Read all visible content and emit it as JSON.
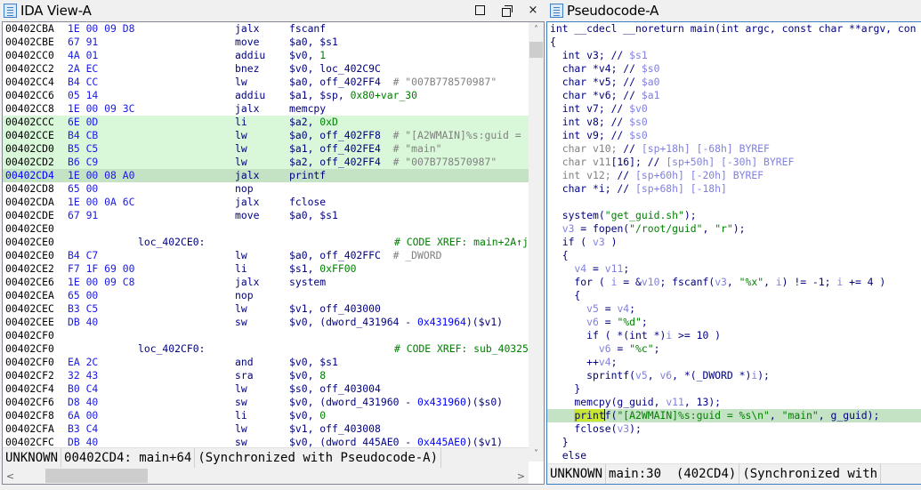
{
  "ida_view": {
    "title": "IDA View-A",
    "window_buttons": {
      "maximize": "maximize-icon",
      "restore": "restore-icon",
      "close": "×"
    },
    "lines": [
      {
        "addr": "00402CBA",
        "bytes": "1E 00 09 D8",
        "mnem": "jalx",
        "ops": "fscanf"
      },
      {
        "addr": "00402CBE",
        "bytes": "67 91",
        "mnem": "move",
        "ops": "$a0, $s1"
      },
      {
        "addr": "00402CC0",
        "bytes": "4A 01",
        "mnem": "addiu",
        "ops": "$v0, ",
        "num": "1"
      },
      {
        "addr": "00402CC2",
        "bytes": "2A EC",
        "mnem": "bnez",
        "ops": "$v0, loc_402C9C"
      },
      {
        "addr": "00402CC4",
        "bytes": "B4 CC",
        "mnem": "lw",
        "ops": "$a0, off_402FF4",
        "comment": "  # \"007B778570987\""
      },
      {
        "addr": "00402CC6",
        "bytes": "05 14",
        "mnem": "addiu",
        "ops": "$a1, $sp, ",
        "num": "0x80+var_30"
      },
      {
        "addr": "00402CC8",
        "bytes": "1E 00 09 3C",
        "mnem": "jalx",
        "ops": "memcpy"
      },
      {
        "addr": "00402CCC",
        "bytes": "6E 0D",
        "mnem": "li",
        "ops": "$a2, ",
        "num": "0xD",
        "state": "hl"
      },
      {
        "addr": "00402CCE",
        "bytes": "B4 CB",
        "mnem": "lw",
        "ops": "$a0, off_402FF8",
        "comment": "  # \"[A2WMAIN]%s:guid =",
        "state": "hl"
      },
      {
        "addr": "00402CD0",
        "bytes": "B5 C5",
        "mnem": "lw",
        "ops": "$a1, off_402FE4",
        "comment": "  # \"main\"",
        "state": "hl"
      },
      {
        "addr": "00402CD2",
        "bytes": "B6 C9",
        "mnem": "lw",
        "ops": "$a2, off_402FF4",
        "comment": "  # \"007B778570987\"",
        "state": "hl"
      },
      {
        "addr": "00402CD4",
        "bytes": "1E 00 08 A0",
        "mnem": "jalx",
        "ops": "printf",
        "state": "cur"
      },
      {
        "addr": "00402CD8",
        "bytes": "65 00",
        "mnem": "nop",
        "ops": ""
      },
      {
        "addr": "00402CDA",
        "bytes": "1E 00 0A 6C",
        "mnem": "jalx",
        "ops": "fclose"
      },
      {
        "addr": "00402CDE",
        "bytes": "67 91",
        "mnem": "move",
        "ops": "$a0, $s1"
      },
      {
        "addr": "00402CE0",
        "bytes": "",
        "mnem": "",
        "ops": ""
      },
      {
        "addr": "00402CE0",
        "label": "loc_402CE0:",
        "xref": "# CODE XREF: main+2A↑j"
      },
      {
        "addr": "00402CE0",
        "bytes": "B4 C7",
        "mnem": "lw",
        "ops": "$a0, off_402FFC",
        "comment": "  # _DWORD"
      },
      {
        "addr": "00402CE2",
        "bytes": "F7 1F 69 00",
        "mnem": "li",
        "ops": "$s1, ",
        "num": "0xFF00"
      },
      {
        "addr": "00402CE6",
        "bytes": "1E 00 09 C8",
        "mnem": "jalx",
        "ops": "system"
      },
      {
        "addr": "00402CEA",
        "bytes": "65 00",
        "mnem": "nop",
        "ops": ""
      },
      {
        "addr": "00402CEC",
        "bytes": "B3 C5",
        "mnem": "lw",
        "ops": "$v1, off_403000"
      },
      {
        "addr": "00402CEE",
        "bytes": "DB 40",
        "mnem": "sw",
        "ops": "$v0, (dword_431964 - ",
        "numblue": "0x431964",
        "ops_tail": ")($v1)"
      },
      {
        "addr": "00402CF0",
        "bytes": "",
        "mnem": "",
        "ops": ""
      },
      {
        "addr": "00402CF0",
        "label": "loc_402CF0:",
        "xref": "# CODE XREF: sub_40325"
      },
      {
        "addr": "00402CF0",
        "bytes": "EA 2C",
        "mnem": "and",
        "ops": "$v0, $s1"
      },
      {
        "addr": "00402CF2",
        "bytes": "32 43",
        "mnem": "sra",
        "ops": "$v0, ",
        "num": "8"
      },
      {
        "addr": "00402CF4",
        "bytes": "B0 C4",
        "mnem": "lw",
        "ops": "$s0, off_403004"
      },
      {
        "addr": "00402CF6",
        "bytes": "D8 40",
        "mnem": "sw",
        "ops": "$v0, (dword_431960 - ",
        "numblue": "0x431960",
        "ops_tail": ")($s0)"
      },
      {
        "addr": "00402CF8",
        "bytes": "6A 00",
        "mnem": "li",
        "ops": "$v0, ",
        "num": "0"
      },
      {
        "addr": "00402CFA",
        "bytes": "B3 C4",
        "mnem": "lw",
        "ops": "$v1, off_403008"
      },
      {
        "addr": "00402CFC",
        "bytes": "DB 40",
        "mnem": "sw",
        "ops": "$v0, (dword_445AE0 - ",
        "numblue": "0x445AE0",
        "ops_tail": ")($v1)"
      }
    ],
    "status": {
      "state": "UNKNOWN",
      "location": "00402CD4: main+64",
      "sync": "(Synchronized with Pseudocode-A)"
    }
  },
  "pseudocode": {
    "title": "Pseudocode-A",
    "lines": [
      [
        [
          "kw",
          "int __cdecl __noreturn main(int argc, const char **argv, con"
        ]
      ],
      [
        [
          "kw",
          "{"
        ]
      ],
      [
        [
          "kw",
          "  int v3; // "
        ],
        [
          "var",
          "$s1"
        ]
      ],
      [
        [
          "kw",
          "  char *v4; // "
        ],
        [
          "var",
          "$s0"
        ]
      ],
      [
        [
          "kw",
          "  char *v5; // "
        ],
        [
          "var",
          "$a0"
        ]
      ],
      [
        [
          "kw",
          "  char *v6; // "
        ],
        [
          "var",
          "$a1"
        ]
      ],
      [
        [
          "kw",
          "  int v7; // "
        ],
        [
          "var",
          "$v0"
        ]
      ],
      [
        [
          "kw",
          "  int v8; // "
        ],
        [
          "var",
          "$s0"
        ]
      ],
      [
        [
          "kw",
          "  int v9; // "
        ],
        [
          "var",
          "$s0"
        ]
      ],
      [
        [
          "grey",
          "  char v10; "
        ],
        [
          "kw",
          "// "
        ],
        [
          "var",
          "[sp+18h] [-68h] BYREF"
        ]
      ],
      [
        [
          "grey",
          "  char v11"
        ],
        [
          "kw",
          "[16]; // "
        ],
        [
          "var",
          "[sp+50h] [-30h] BYREF"
        ]
      ],
      [
        [
          "grey",
          "  int v12; "
        ],
        [
          "kw",
          "// "
        ],
        [
          "var",
          "[sp+60h] [-20h] BYREF"
        ]
      ],
      [
        [
          "kw",
          "  char *i; // "
        ],
        [
          "var",
          "[sp+68h] [-18h]"
        ]
      ],
      [
        [
          "kw",
          ""
        ]
      ],
      [
        [
          "kw",
          "  system("
        ],
        [
          "str",
          "\"get_guid.sh\""
        ],
        [
          "kw",
          ");"
        ]
      ],
      [
        [
          "var",
          "  v3"
        ],
        [
          "kw",
          " = fopen("
        ],
        [
          "str",
          "\"/root/guid\""
        ],
        [
          "kw",
          ", "
        ],
        [
          "str",
          "\"r\""
        ],
        [
          "kw",
          ");"
        ]
      ],
      [
        [
          "kw",
          "  if ( "
        ],
        [
          "var",
          "v3"
        ],
        [
          "kw",
          " )"
        ]
      ],
      [
        [
          "kw",
          "  {"
        ]
      ],
      [
        [
          "var",
          "    v4"
        ],
        [
          "kw",
          " = "
        ],
        [
          "var",
          "v11"
        ],
        [
          "kw",
          ";"
        ]
      ],
      [
        [
          "kw",
          "    for ( "
        ],
        [
          "var",
          "i"
        ],
        [
          "kw",
          " = &"
        ],
        [
          "var",
          "v10"
        ],
        [
          "kw",
          "; fscanf("
        ],
        [
          "var",
          "v3"
        ],
        [
          "kw",
          ", "
        ],
        [
          "str",
          "\"%x\""
        ],
        [
          "kw",
          ", "
        ],
        [
          "var",
          "i"
        ],
        [
          "kw",
          ") != -1; "
        ],
        [
          "var",
          "i"
        ],
        [
          "kw",
          " += 4 )"
        ]
      ],
      [
        [
          "kw",
          "    {"
        ]
      ],
      [
        [
          "var",
          "      v5"
        ],
        [
          "kw",
          " = "
        ],
        [
          "var",
          "v4"
        ],
        [
          "kw",
          ";"
        ]
      ],
      [
        [
          "var",
          "      v6"
        ],
        [
          "kw",
          " = "
        ],
        [
          "str",
          "\"%d\""
        ],
        [
          "kw",
          ";"
        ]
      ],
      [
        [
          "kw",
          "      if ( *(int *)"
        ],
        [
          "var",
          "i"
        ],
        [
          "kw",
          " >= 10 )"
        ]
      ],
      [
        [
          "var",
          "        v6"
        ],
        [
          "kw",
          " = "
        ],
        [
          "str",
          "\"%c\""
        ],
        [
          "kw",
          ";"
        ]
      ],
      [
        [
          "kw",
          "      ++"
        ],
        [
          "var",
          "v4"
        ],
        [
          "kw",
          ";"
        ]
      ],
      [
        [
          "kw",
          "      sprintf("
        ],
        [
          "var",
          "v5"
        ],
        [
          "kw",
          ", "
        ],
        [
          "var",
          "v6"
        ],
        [
          "kw",
          ", *(_DWORD *)"
        ],
        [
          "var",
          "i"
        ],
        [
          "kw",
          ");"
        ]
      ],
      [
        [
          "kw",
          "    }"
        ]
      ],
      [
        [
          "kw",
          "    memcpy(g_guid, "
        ],
        [
          "var",
          "v11"
        ],
        [
          "kw",
          ", 13);"
        ]
      ],
      [
        [
          "caretline",
          "    printf(\"[A2WMAIN]%s:guid = %s\\n\", \"main\", g_guid);"
        ]
      ],
      [
        [
          "kw",
          "    fclose("
        ],
        [
          "var",
          "v3"
        ],
        [
          "kw",
          ");"
        ]
      ],
      [
        [
          "kw",
          "  }"
        ]
      ],
      [
        [
          "kw",
          "  else"
        ]
      ]
    ],
    "status": {
      "state": "UNKNOWN",
      "location": "main:30",
      "address": "(402CD4)",
      "sync": "(Synchronized with"
    }
  },
  "colors": {
    "highlight": "#d9f7d9",
    "current_line": "#c4e2c4",
    "word_highlight": "#c8e632",
    "address": "#000000",
    "bytes": "#1a1ae6",
    "code": "#000080",
    "number": "#008000",
    "comment": "#808080",
    "variable": "#8080e0"
  }
}
